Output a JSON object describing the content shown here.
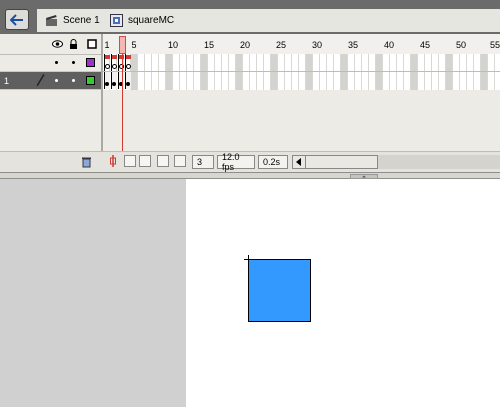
{
  "editbar": {
    "back_icon": "back-arrow-icon",
    "scene_label": "Scene 1",
    "scene_icon": "clapperboard-icon",
    "symbol_label": "squareMC",
    "symbol_icon": "movieclip-symbol-icon"
  },
  "timeline": {
    "header_icons": [
      "eye-icon",
      "lock-icon",
      "outline-icon"
    ],
    "ruler_labels": [
      "1",
      "5",
      "10",
      "15",
      "20",
      "25",
      "30",
      "35",
      "40",
      "45",
      "50",
      "55"
    ],
    "current_frame": "3",
    "frame_rate": "12.0 fps",
    "elapsed_time": "0.2s",
    "layers": [
      {
        "name": "",
        "selected": false,
        "swatch_color": "#9933cc"
      },
      {
        "name": "1",
        "selected": true,
        "swatch_color": "#33cc33"
      }
    ]
  },
  "colors": {
    "square_fill": "#3399ff",
    "stage_bg": "#ffffff",
    "workspace_bg": "#d0d0d0",
    "playhead": "#d23a32"
  }
}
